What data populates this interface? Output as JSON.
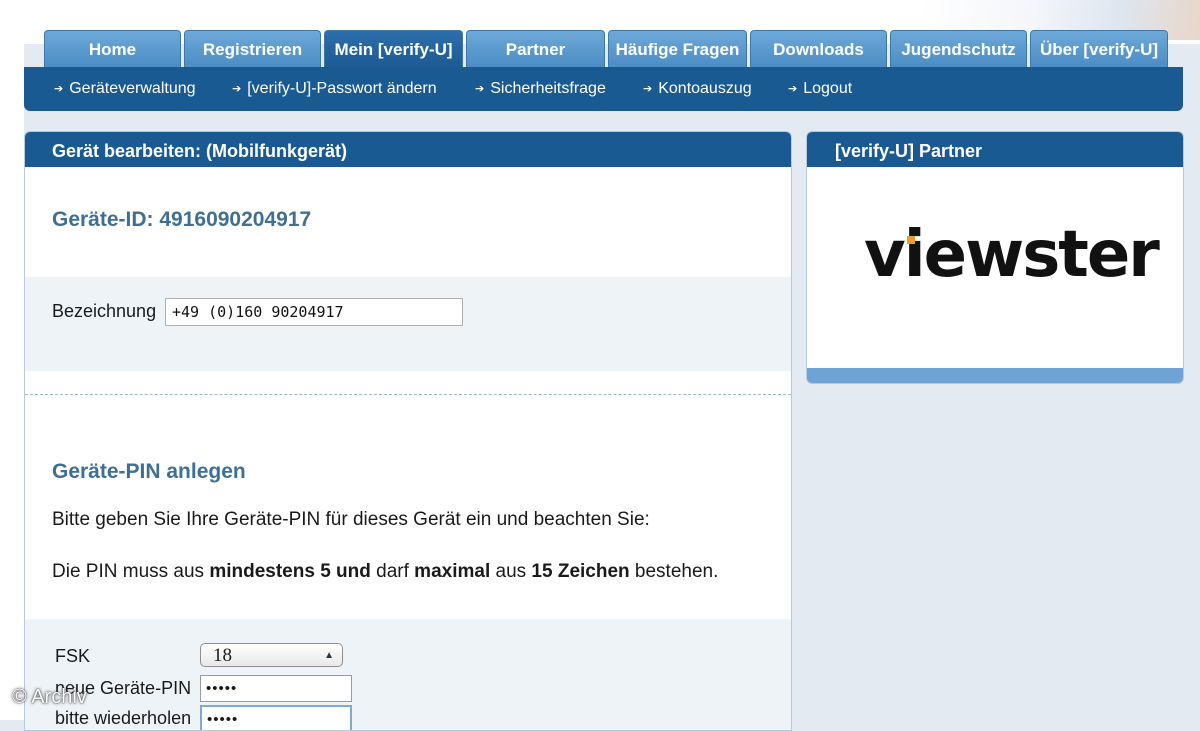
{
  "tabs": [
    {
      "label": "Home"
    },
    {
      "label": "Registrieren"
    },
    {
      "label": "Mein [verify-U]"
    },
    {
      "label": "Partner"
    },
    {
      "label": "Häufige Fragen"
    },
    {
      "label": "Downloads"
    },
    {
      "label": "Jugendschutz"
    },
    {
      "label": "Über [verify-U]"
    }
  ],
  "active_tab": "Mein [verify-U]",
  "subnav": [
    {
      "label": "Geräteverwaltung",
      "icon": "arrow-right-icon"
    },
    {
      "label": "[verify-U]-Passwort ändern",
      "icon": "arrow-right-icon"
    },
    {
      "label": "Sicherheitsfrage",
      "icon": "arrow-right-icon"
    },
    {
      "label": "Kontoauszug",
      "icon": "arrow-right-icon"
    },
    {
      "label": "Logout",
      "icon": "arrow-right-icon"
    }
  ],
  "main": {
    "title": "Gerät bearbeiten: (Mobilfunkgerät)",
    "device_id": "Geräte-ID: 4916090204917",
    "bezeichnung_label": "Bezeichnung",
    "bezeichnung_value": "+49 (0)160 90204917",
    "pin_title": "Geräte-PIN anlegen",
    "pin_intro": "Bitte geben Sie Ihre Geräte-PIN für dieses Gerät ein und beachten Sie:",
    "pin_rule": {
      "p1": "Die PIN muss aus ",
      "b1": "mindestens 5 und",
      "p2": " darf ",
      "b2": "maximal",
      "p3": " aus ",
      "b3": "15 Zeichen",
      "p4": " bestehen."
    },
    "fsk_label": "FSK",
    "fsk_value": "18",
    "new_pin_label": "neue Geräte-PIN",
    "new_pin_value": "•••••",
    "repeat_label": "bitte wiederholen",
    "repeat_value": "•••••"
  },
  "side": {
    "title": "[verify-U] Partner",
    "partner_logo_text": "viewster"
  },
  "watermark": "© Archiv",
  "colors": {
    "nav_dark": "#1a5a92",
    "tab_light": "#5b9bd0",
    "heading_blue": "#3f6f94",
    "band": "#eef3f8",
    "logo_accent": "#e7a12a"
  }
}
